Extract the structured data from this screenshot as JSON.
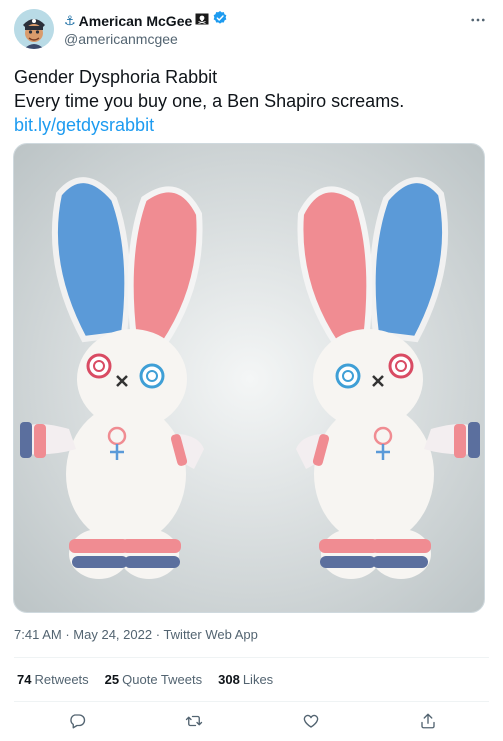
{
  "author": {
    "display_name": "American McGee",
    "handle": "@americanmcgee",
    "anchor_emoji": "⚓",
    "verified": true
  },
  "tweet": {
    "line1": "Gender Dysphoria Rabbit",
    "line2": "Every time you buy one, a Ben Shapiro screams.",
    "link": "bit.ly/getdysrabbit"
  },
  "meta": {
    "time": "7:41 AM",
    "separator": "·",
    "date": "May 24, 2022",
    "source": "Twitter Web App"
  },
  "stats": {
    "retweets_count": "74",
    "retweets_label": "Retweets",
    "quotes_count": "25",
    "quotes_label": "Quote Tweets",
    "likes_count": "308",
    "likes_label": "Likes"
  },
  "icons": {
    "more": "more-icon",
    "reply": "reply-icon",
    "retweet": "retweet-icon",
    "like": "heart-icon",
    "share": "share-icon"
  },
  "colors": {
    "link": "#1d9bf0",
    "verified": "#1d9bf0",
    "muted": "#536471",
    "rabbit_blue": "#5b9ad8",
    "rabbit_pink": "#f08c92"
  }
}
